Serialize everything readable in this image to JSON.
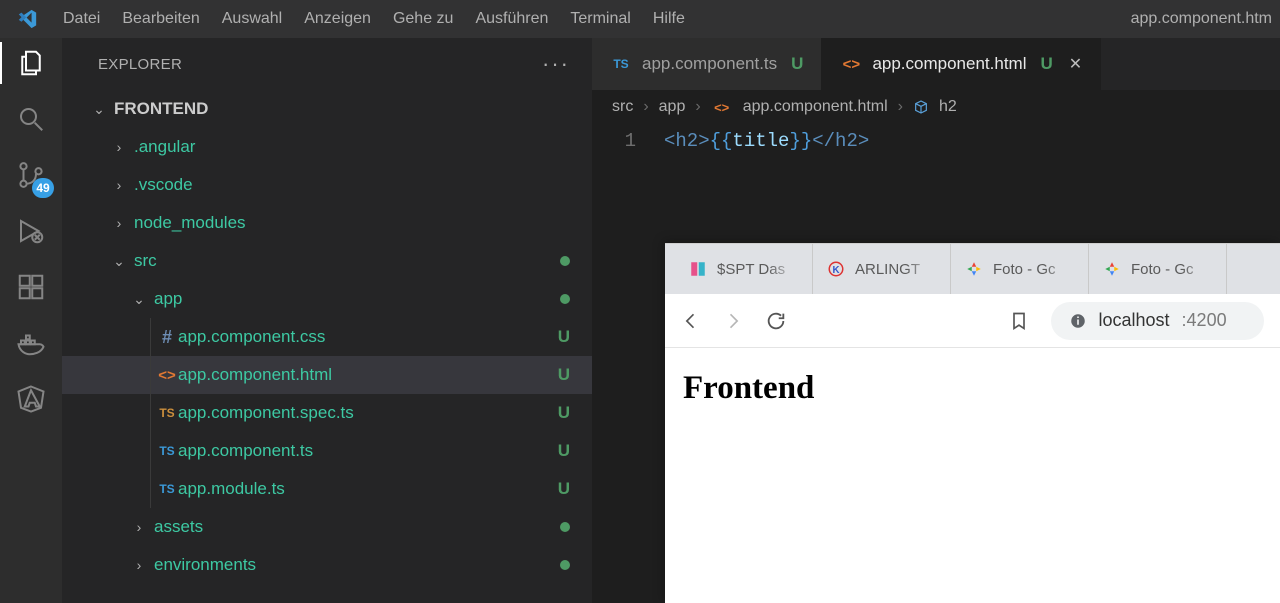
{
  "menu": [
    "Datei",
    "Bearbeiten",
    "Auswahl",
    "Anzeigen",
    "Gehe zu",
    "Ausführen",
    "Terminal",
    "Hilfe"
  ],
  "titleRight": "app.component.htm",
  "activity": {
    "scmBadge": "49"
  },
  "explorer": {
    "title": "EXPLORER",
    "root": "FRONTEND",
    "items": [
      {
        "kind": "folder",
        "indent": 2,
        "chev": ">",
        "label": ".angular"
      },
      {
        "kind": "folder",
        "indent": 2,
        "chev": ">",
        "label": ".vscode"
      },
      {
        "kind": "folder",
        "indent": 2,
        "chev": ">",
        "label": "node_modules"
      },
      {
        "kind": "folder",
        "indent": 2,
        "chev": "v",
        "label": "src",
        "dot": true
      },
      {
        "kind": "folder",
        "indent": 3,
        "chev": "v",
        "label": "app",
        "dot": true
      },
      {
        "kind": "file",
        "indent": 4,
        "icon": "hash",
        "label": "app.component.css",
        "u": true
      },
      {
        "kind": "file",
        "indent": 4,
        "icon": "html",
        "label": "app.component.html",
        "u": true,
        "active": true
      },
      {
        "kind": "file",
        "indent": 4,
        "icon": "ts2",
        "label": "app.component.spec.ts",
        "u": true
      },
      {
        "kind": "file",
        "indent": 4,
        "icon": "ts",
        "label": "app.component.ts",
        "u": true
      },
      {
        "kind": "file",
        "indent": 4,
        "icon": "ts",
        "label": "app.module.ts",
        "u": true
      },
      {
        "kind": "folder",
        "indent": 3,
        "chev": ">",
        "label": "assets",
        "dot": true
      },
      {
        "kind": "folder",
        "indent": 3,
        "chev": ">",
        "label": "environments",
        "dot": true
      }
    ]
  },
  "tabs": [
    {
      "icon": "ts",
      "label": "app.component.ts",
      "u": "U",
      "active": false
    },
    {
      "icon": "html",
      "label": "app.component.html",
      "u": "U",
      "active": true,
      "close": true
    }
  ],
  "breadcrumbs": {
    "seg1": "src",
    "seg2": "app",
    "seg3": "app.component.html",
    "seg4": "h2"
  },
  "code": {
    "lineNo": "1",
    "openTag": "<h2>",
    "lbrace": "{{",
    "ident": "title",
    "rbrace": "}}",
    "closeTag": "</h2>"
  },
  "browser": {
    "tabs": [
      {
        "label": "$SPT Das"
      },
      {
        "label": "ARLINGT"
      },
      {
        "label": "Foto - Gc"
      },
      {
        "label": "Foto - Gc"
      }
    ],
    "urlHost": "localhost",
    "urlPort": ":4200",
    "heading": "Frontend"
  }
}
